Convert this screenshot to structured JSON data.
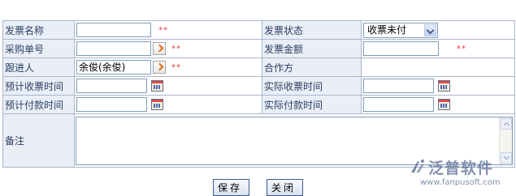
{
  "form": {
    "invoice_name": {
      "label": "发票名称",
      "value": "",
      "required_mark": "**"
    },
    "invoice_status": {
      "label": "发票状态",
      "selected": "收票未付"
    },
    "purchase_no": {
      "label": "采购单号",
      "value": "",
      "required_mark": "**"
    },
    "invoice_amount": {
      "label": "发票金额",
      "value": "",
      "required_mark": "**"
    },
    "follower": {
      "label": "跟进人",
      "value": "余俊(余俊)",
      "required_mark": "**"
    },
    "partner": {
      "label": "合作方",
      "value": ""
    },
    "expected_receipt_time": {
      "label": "预计收票时间",
      "value": ""
    },
    "actual_receipt_time": {
      "label": "实际收票时间",
      "value": ""
    },
    "expected_payment_time": {
      "label": "预计付款时间",
      "value": ""
    },
    "actual_payment_time": {
      "label": "实际付款时间",
      "value": ""
    },
    "remark": {
      "label": "备注",
      "value": ""
    }
  },
  "buttons": {
    "save": "保存",
    "close": "关闭"
  },
  "watermark": {
    "brand": "泛普软件",
    "url": "www.fanpusoft.com"
  }
}
